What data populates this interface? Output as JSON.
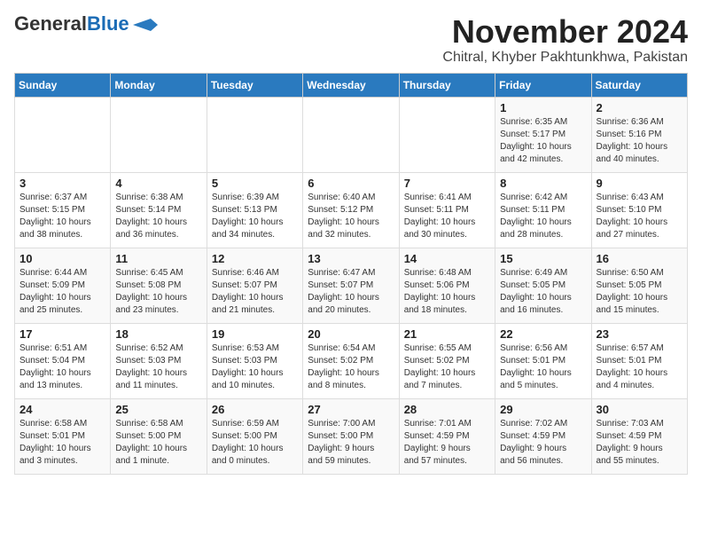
{
  "header": {
    "logo_general": "General",
    "logo_blue": "Blue",
    "month_title": "November 2024",
    "location": "Chitral, Khyber Pakhtunkhwa, Pakistan"
  },
  "weekdays": [
    "Sunday",
    "Monday",
    "Tuesday",
    "Wednesday",
    "Thursday",
    "Friday",
    "Saturday"
  ],
  "weeks": [
    [
      {
        "day": "",
        "info": ""
      },
      {
        "day": "",
        "info": ""
      },
      {
        "day": "",
        "info": ""
      },
      {
        "day": "",
        "info": ""
      },
      {
        "day": "",
        "info": ""
      },
      {
        "day": "1",
        "info": "Sunrise: 6:35 AM\nSunset: 5:17 PM\nDaylight: 10 hours\nand 42 minutes."
      },
      {
        "day": "2",
        "info": "Sunrise: 6:36 AM\nSunset: 5:16 PM\nDaylight: 10 hours\nand 40 minutes."
      }
    ],
    [
      {
        "day": "3",
        "info": "Sunrise: 6:37 AM\nSunset: 5:15 PM\nDaylight: 10 hours\nand 38 minutes."
      },
      {
        "day": "4",
        "info": "Sunrise: 6:38 AM\nSunset: 5:14 PM\nDaylight: 10 hours\nand 36 minutes."
      },
      {
        "day": "5",
        "info": "Sunrise: 6:39 AM\nSunset: 5:13 PM\nDaylight: 10 hours\nand 34 minutes."
      },
      {
        "day": "6",
        "info": "Sunrise: 6:40 AM\nSunset: 5:12 PM\nDaylight: 10 hours\nand 32 minutes."
      },
      {
        "day": "7",
        "info": "Sunrise: 6:41 AM\nSunset: 5:11 PM\nDaylight: 10 hours\nand 30 minutes."
      },
      {
        "day": "8",
        "info": "Sunrise: 6:42 AM\nSunset: 5:11 PM\nDaylight: 10 hours\nand 28 minutes."
      },
      {
        "day": "9",
        "info": "Sunrise: 6:43 AM\nSunset: 5:10 PM\nDaylight: 10 hours\nand 27 minutes."
      }
    ],
    [
      {
        "day": "10",
        "info": "Sunrise: 6:44 AM\nSunset: 5:09 PM\nDaylight: 10 hours\nand 25 minutes."
      },
      {
        "day": "11",
        "info": "Sunrise: 6:45 AM\nSunset: 5:08 PM\nDaylight: 10 hours\nand 23 minutes."
      },
      {
        "day": "12",
        "info": "Sunrise: 6:46 AM\nSunset: 5:07 PM\nDaylight: 10 hours\nand 21 minutes."
      },
      {
        "day": "13",
        "info": "Sunrise: 6:47 AM\nSunset: 5:07 PM\nDaylight: 10 hours\nand 20 minutes."
      },
      {
        "day": "14",
        "info": "Sunrise: 6:48 AM\nSunset: 5:06 PM\nDaylight: 10 hours\nand 18 minutes."
      },
      {
        "day": "15",
        "info": "Sunrise: 6:49 AM\nSunset: 5:05 PM\nDaylight: 10 hours\nand 16 minutes."
      },
      {
        "day": "16",
        "info": "Sunrise: 6:50 AM\nSunset: 5:05 PM\nDaylight: 10 hours\nand 15 minutes."
      }
    ],
    [
      {
        "day": "17",
        "info": "Sunrise: 6:51 AM\nSunset: 5:04 PM\nDaylight: 10 hours\nand 13 minutes."
      },
      {
        "day": "18",
        "info": "Sunrise: 6:52 AM\nSunset: 5:03 PM\nDaylight: 10 hours\nand 11 minutes."
      },
      {
        "day": "19",
        "info": "Sunrise: 6:53 AM\nSunset: 5:03 PM\nDaylight: 10 hours\nand 10 minutes."
      },
      {
        "day": "20",
        "info": "Sunrise: 6:54 AM\nSunset: 5:02 PM\nDaylight: 10 hours\nand 8 minutes."
      },
      {
        "day": "21",
        "info": "Sunrise: 6:55 AM\nSunset: 5:02 PM\nDaylight: 10 hours\nand 7 minutes."
      },
      {
        "day": "22",
        "info": "Sunrise: 6:56 AM\nSunset: 5:01 PM\nDaylight: 10 hours\nand 5 minutes."
      },
      {
        "day": "23",
        "info": "Sunrise: 6:57 AM\nSunset: 5:01 PM\nDaylight: 10 hours\nand 4 minutes."
      }
    ],
    [
      {
        "day": "24",
        "info": "Sunrise: 6:58 AM\nSunset: 5:01 PM\nDaylight: 10 hours\nand 3 minutes."
      },
      {
        "day": "25",
        "info": "Sunrise: 6:58 AM\nSunset: 5:00 PM\nDaylight: 10 hours\nand 1 minute."
      },
      {
        "day": "26",
        "info": "Sunrise: 6:59 AM\nSunset: 5:00 PM\nDaylight: 10 hours\nand 0 minutes."
      },
      {
        "day": "27",
        "info": "Sunrise: 7:00 AM\nSunset: 5:00 PM\nDaylight: 9 hours\nand 59 minutes."
      },
      {
        "day": "28",
        "info": "Sunrise: 7:01 AM\nSunset: 4:59 PM\nDaylight: 9 hours\nand 57 minutes."
      },
      {
        "day": "29",
        "info": "Sunrise: 7:02 AM\nSunset: 4:59 PM\nDaylight: 9 hours\nand 56 minutes."
      },
      {
        "day": "30",
        "info": "Sunrise: 7:03 AM\nSunset: 4:59 PM\nDaylight: 9 hours\nand 55 minutes."
      }
    ]
  ]
}
